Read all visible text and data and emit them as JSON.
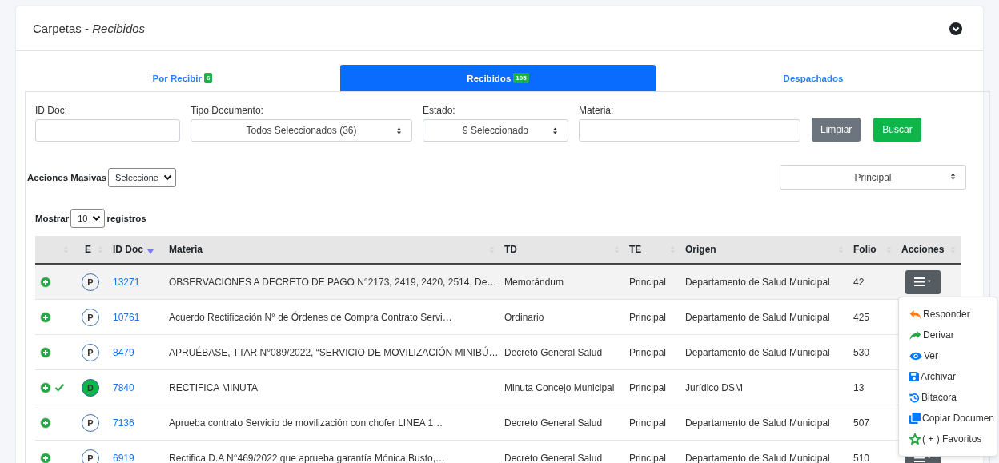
{
  "card": {
    "title": "Carpetas - *Recibidos*"
  },
  "tabs": [
    {
      "label": "Por Recibir",
      "badge": "6",
      "selected": false
    },
    {
      "label": "Recibidos",
      "badge": "105",
      "selected": true
    },
    {
      "label": "Despachados",
      "selected": false
    }
  ],
  "filters": [
    {
      "label": "ID Doc:",
      "kind": "input"
    },
    {
      "label": "Tipo Documento:",
      "kind": "select",
      "value": "Todos Seleccionados (36)"
    },
    {
      "label": "Estado:",
      "kind": "select",
      "value": "9 Seleccionado"
    },
    {
      "label": "Materia:",
      "kind": "input"
    }
  ],
  "buttons": [
    {
      "label": "Limpiar",
      "kind": "secondary"
    },
    {
      "label": "Buscar",
      "kind": "success"
    }
  ],
  "bulk": {
    "label": "Acciones Masivas",
    "value": "Seleccione"
  },
  "view_select": {
    "value": "Principal"
  },
  "length": {
    "before": "Mostrar",
    "value": "10",
    "after": "registros"
  },
  "table": {
    "columns": [
      {
        "sorted": false
      },
      {
        "label": "E",
        "sorted": false
      },
      {
        "label": "ID Doc",
        "sorted": true
      },
      {
        "label": "Materia",
        "sorted": false
      },
      {
        "label": "TD",
        "sorted": false
      },
      {
        "label": "TE",
        "sorted": false
      },
      {
        "label": "Origen",
        "sorted": false
      },
      {
        "label": "Folio",
        "sorted": false
      },
      {
        "label": "Acciones",
        "sorted": false
      }
    ],
    "rows": [
      {
        "checked": false,
        "estado": "P",
        "filled": false,
        "id": "13271",
        "materia": "OBSERVACIONES A DECRETO DE PAGO N°2173, 2419, 2420, 2514, De…",
        "td": "Memorándum",
        "te": "Principal",
        "origen": "Departamento de Salud Municipal",
        "folio": "42",
        "selected": true
      },
      {
        "checked": false,
        "estado": "P",
        "filled": false,
        "id": "10761",
        "materia": "Acuerdo Rectificación N° de Órdenes de Compra Contrato Servi…",
        "td": "Ordinario",
        "te": "Principal",
        "origen": "Departamento de Salud Municipal",
        "folio": "425",
        "selected": false
      },
      {
        "checked": false,
        "estado": "P",
        "filled": false,
        "id": "8479",
        "materia": "APRUÉBASE, TTAR N°089/2022, “SERVICIO DE MOVILIZACIÓN MINIBÚ…",
        "td": "Decreto General Salud",
        "te": "Principal",
        "origen": "Departamento de Salud Municipal",
        "folio": "530",
        "selected": false
      },
      {
        "checked": true,
        "estado": "D",
        "filled": true,
        "id": "7840",
        "materia": "RECTIFICA MINUTA",
        "td": "Minuta Concejo Municipal",
        "te": "Principal",
        "origen": "Jurídico DSM",
        "folio": "13",
        "selected": false
      },
      {
        "checked": false,
        "estado": "P",
        "filled": false,
        "id": "7136",
        "materia": "Aprueba contrato Servicio de movilización con chofer LINEA 1…",
        "td": "Decreto General Salud",
        "te": "Principal",
        "origen": "Departamento de Salud Municipal",
        "folio": "507",
        "selected": false
      },
      {
        "checked": false,
        "estado": "P",
        "filled": false,
        "id": "6919",
        "materia": "Rectifica D.A N°469/2022 que aprueba garantía Mónica Busto,…",
        "td": "Decreto General Salud",
        "te": "Principal",
        "origen": "Departamento de Salud Municipal",
        "folio": "510",
        "selected": false
      }
    ]
  },
  "actions_menu": [
    {
      "label": "Responder",
      "kind": "reply",
      "color": "#fd7e14"
    },
    {
      "label": "Derivar",
      "kind": "forward",
      "color": "#28a745"
    },
    {
      "label": "Ver",
      "kind": "eye",
      "color": "#007bff"
    },
    {
      "label": "Archivar",
      "kind": "save",
      "color": "#007bff"
    },
    {
      "label": "Bitacora",
      "kind": "history",
      "color": "#007bff"
    },
    {
      "label": "Copiar Documen",
      "kind": "copy",
      "color": "#007bff"
    },
    {
      "label": "( + ) Favoritos",
      "kind": "star",
      "color": "#28a745"
    }
  ]
}
